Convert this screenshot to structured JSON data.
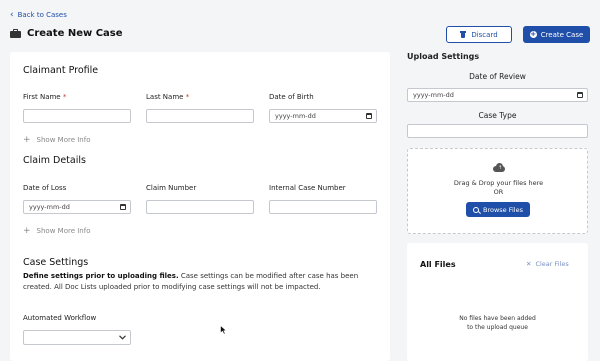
{
  "nav": {
    "back_label": "Back to Cases"
  },
  "header": {
    "title": "Create New Case"
  },
  "actions": {
    "discard_label": "Discard",
    "create_label": "Create Case"
  },
  "claimant": {
    "title": "Claimant Profile",
    "first_name_label": "First Name",
    "last_name_label": "Last Name",
    "dob_label": "Date of Birth",
    "dob_placeholder": "yyyy-mm-dd",
    "show_more": "Show More Info"
  },
  "claim": {
    "title": "Claim Details",
    "date_of_loss_label": "Date of Loss",
    "date_of_loss_placeholder": "yyyy-mm-dd",
    "claim_number_label": "Claim Number",
    "internal_case_label": "Internal Case Number",
    "show_more": "Show More Info"
  },
  "case_settings": {
    "title": "Case Settings",
    "desc_bold": "Define settings prior to uploading files.",
    "desc_rest": " Case settings can be modified after case has been created. All Doc Lists uploaded prior to modifying case settings will not be impacted.",
    "workflow_label": "Automated Workflow"
  },
  "upload": {
    "title": "Upload Settings",
    "review_label": "Date of Review",
    "review_placeholder": "yyyy-mm-dd",
    "case_type_label": "Case Type",
    "drop_text": "Drag & Drop your files here",
    "or_text": "OR",
    "browse_label": "Browse Files"
  },
  "files": {
    "title": "All Files",
    "clear_label": "Clear Files",
    "empty_line1": "No files have been added",
    "empty_line2": "to the upload queue"
  },
  "colors": {
    "primary": "#1f4fa8",
    "required": "#c0392b"
  }
}
